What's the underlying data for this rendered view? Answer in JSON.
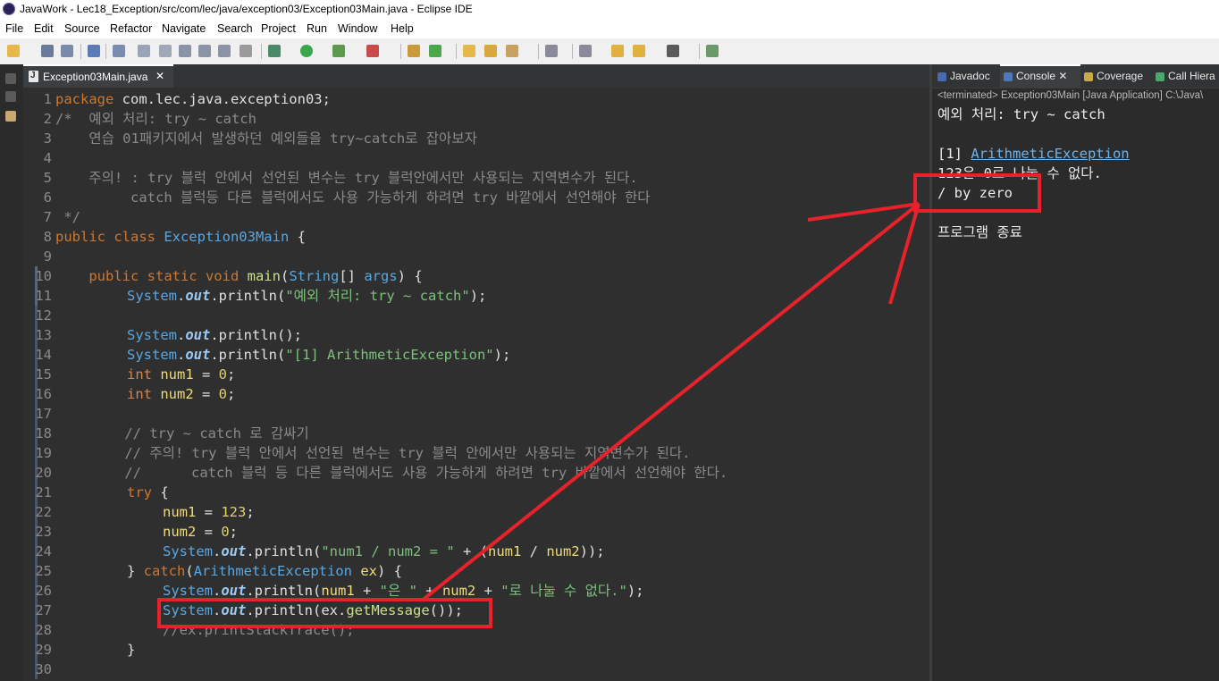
{
  "window": {
    "title": "JavaWork - Lec18_Exception/src/com/lec/java/exception03/Exception03Main.java - Eclipse IDE"
  },
  "menu": {
    "items": [
      "File",
      "Edit",
      "Source",
      "Refactor",
      "Navigate",
      "Search",
      "Project",
      "Run",
      "Window",
      "Help"
    ]
  },
  "editor": {
    "tab_label": "Exception03Main.java",
    "tab_close": "✕",
    "line_numbers": [
      "1",
      "2",
      "3",
      "4",
      "5",
      "6",
      "7",
      "8",
      "9",
      "10",
      "11",
      "12",
      "13",
      "14",
      "15",
      "16",
      "17",
      "18",
      "19",
      "20",
      "21",
      "22",
      "23",
      "24",
      "25",
      "26",
      "27",
      "28",
      "29",
      "30"
    ],
    "code": {
      "l1_kw": "package",
      "l1_rest": " com.lec.java.exception03;",
      "l2": "/*  예외 처리: try ~ catch",
      "l3": "    연습 01패키지에서 발생하던 예외들을 try~catch로 잡아보자",
      "l5": "    주의! : try 블럭 안에서 선언된 변수는 try 블럭안에서만 사용되는 지역변수가 된다.",
      "l6": "         catch 블럭등 다른 블럭에서도 사용 가능하게 하려면 try 바깥에서 선언해야 한다",
      "l7": " */",
      "l8_kw": "public class",
      "l8_cls": " Exception03Main",
      "l8_rest": " {",
      "l10_kw": "    public static void",
      "l10_m": " main",
      "l10_p": "(",
      "l10_t": "String",
      "l10_p2": "[] ",
      "l10_a": "args",
      "l10_p3": ") {",
      "sys": "System",
      "dot": ".",
      "out": "out",
      "println": ".println(",
      "l11_str": "\"예외 처리: try ~ catch\"",
      "end": ");",
      "l13_rest": ".println();",
      "l14_str": "\"[1] ArithmeticException\"",
      "int_kw": "int",
      "l15_var": " num1",
      "l16_var": " num2",
      "eq0": " = ",
      "zero": "0",
      "semi": ";",
      "l18": "    // try ~ catch 로 감싸기",
      "l19": "    // 주의! try 블럭 안에서 선언된 변수는 try 블럭 안에서만 사용되는 지역변수가 된다.",
      "l20": "    //      catch 블럭 등 다른 블럭에서도 사용 가능하게 하려면 try 바깥에서 선언해야 한다.",
      "l21_kw": "try",
      "l21_rest": " {",
      "l22_var": "num1",
      "l22_val": "123",
      "l23_var": "num2",
      "l24_str": "\"num1 / num2 = \"",
      "l24_plus": " + (",
      "l24_n1": "num1",
      "l24_div": " / ",
      "l24_n2": "num2",
      "l24_end": "));",
      "l25_a": "} ",
      "l25_kw": "catch",
      "l25_p": "(",
      "l25_cls": "ArithmeticException",
      "l25_var": " ex",
      "l25_end": ") {",
      "l26_n1": "num1",
      "l26_s1": "\"은 \"",
      "l26_n2": "num2",
      "l26_s2": "\"로 나눌 수 없다.\"",
      "plus": " + ",
      "l27_mid": "ex.",
      "l27_meth": "getMessage",
      "l27_end": "());",
      "l28": "//ex.printStackTrace();",
      "l29": "}"
    }
  },
  "views": {
    "tabs": [
      "Javadoc",
      "Console",
      "Coverage",
      "Call Hiera"
    ],
    "console_close": "✕",
    "status": "<terminated> Exception03Main [Java Application] C:\\Java\\",
    "output": {
      "line1": "예외 처리: try ~ catch",
      "line2_prefix": "[1] ",
      "line2_link": "ArithmeticException",
      "line3": "123은 0로 나눌 수 없다.",
      "line4": "/ by zero",
      "line6": "프로그램 종료"
    }
  },
  "colors": {
    "annotation": "#e8222a"
  }
}
